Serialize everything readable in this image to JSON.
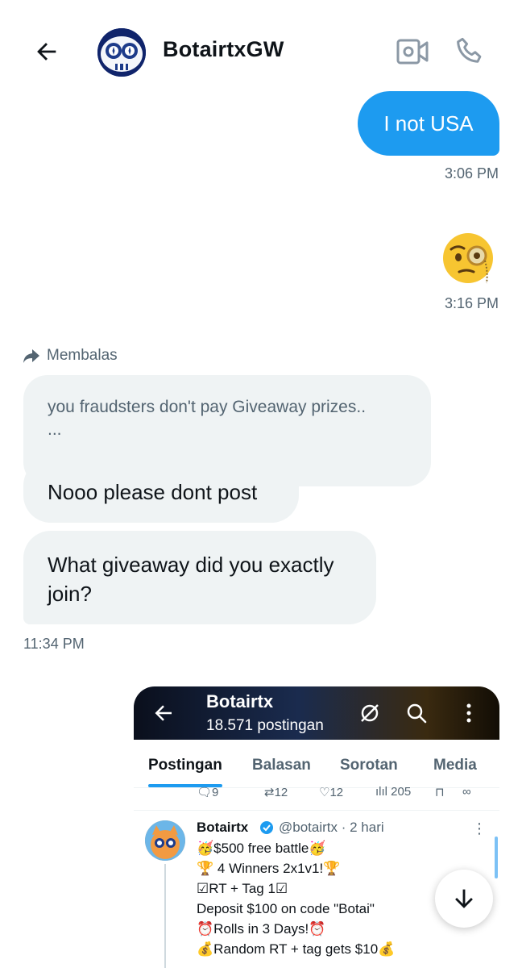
{
  "header": {
    "contact_name": "BotairtxGW",
    "icons": {
      "back": "arrow-left-icon",
      "video": "video-camera-icon",
      "call": "phone-icon"
    }
  },
  "messages": {
    "outgoing_1": {
      "text": "I not USA",
      "time": "3:06 PM"
    },
    "outgoing_2": {
      "emoji": "face-with-monocle",
      "time": "3:16 PM"
    },
    "reply_context": {
      "label": "Membalas",
      "quoted_text": "you fraudsters don't pay Giveaway prizes..",
      "quoted_more": "..."
    },
    "incoming_1": {
      "text": "Nooo please dont post"
    },
    "incoming_2": {
      "text": "What giveaway did you exactly join?",
      "time": "11:34 PM"
    }
  },
  "embedded_screenshot": {
    "profile_name": "Botairtx",
    "post_count": "18.571 postingan",
    "tabs": [
      "Postingan",
      "Balasan",
      "Sorotan",
      "Media"
    ],
    "active_tab": "Postingan",
    "prev_post_stats": {
      "replies": "9",
      "reposts": "12",
      "likes": "12",
      "views": "205"
    },
    "post": {
      "author": "Botairtx",
      "handle_time": "@botairtx · 2 hari",
      "lines": [
        "🥳$500 free battle🥳",
        "🏆 4 Winners 2x1v1!🏆",
        "☑RT + Tag 1☑",
        "Deposit $100 on code \"Botai\"",
        "⏰Rolls in 3 Days!⏰",
        "💰Random RT + tag gets $10💰"
      ]
    }
  },
  "colors": {
    "accent": "#1d9bf0",
    "bubble_in": "#eff3f4",
    "muted": "#536471"
  }
}
